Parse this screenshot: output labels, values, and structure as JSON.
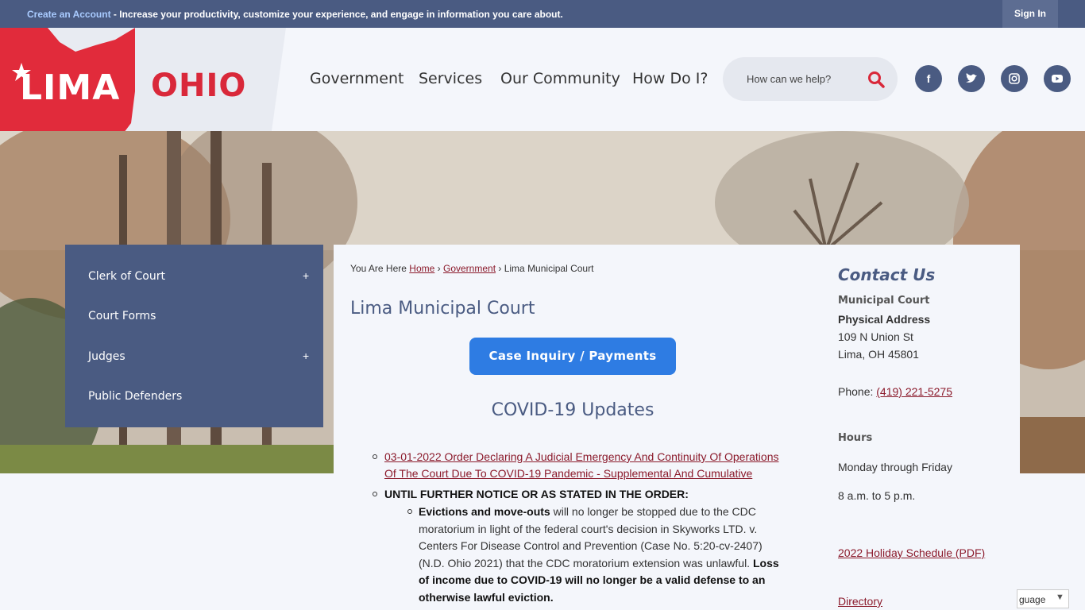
{
  "topbar": {
    "create_account": "Create an Account",
    "message": " - Increase your productivity, customize your experience, and engage in information you care about.",
    "sign_in": "Sign In"
  },
  "logo": {
    "lima": "LIMA",
    "ohio": "OHIO"
  },
  "nav": {
    "items": [
      "Government",
      "Services",
      "Our Community",
      "How Do I?"
    ]
  },
  "search": {
    "placeholder": "How can we help?"
  },
  "social": {
    "facebook": "f",
    "twitter": "t",
    "instagram": "ig",
    "youtube": "yt"
  },
  "sidebar": {
    "items": [
      {
        "label": "Clerk of Court",
        "expand": "+"
      },
      {
        "label": "Court Forms",
        "expand": ""
      },
      {
        "label": "Judges",
        "expand": "+"
      },
      {
        "label": "Public Defenders",
        "expand": ""
      }
    ]
  },
  "breadcrumb": {
    "prefix": "You Are Here",
    "home": "Home",
    "government": "Government",
    "current": "Lima Municipal Court",
    "sep": "›"
  },
  "main": {
    "title": "Lima Municipal Court",
    "case_button": "Case Inquiry / Payments",
    "covid_heading": "COVID-19 Updates",
    "order_link_1": "03-01-2022 Order Declaring A Judicial Emergency And Continuity Of Operations",
    "order_link_2": "Of The Court Due To COVID-19 Pandemic - Supplemental And Cumulative",
    "notice": "UNTIL FURTHER NOTICE OR AS STATED IN THE ORDER:",
    "evictions_bold": "Evictions and move-outs",
    "evictions_1": " will no longer be stopped due to the CDC",
    "evictions_2": "moratorium in light of the federal court's decision in Skyworks LTD. v.",
    "evictions_3": "Centers For Disease Control and Prevention (Case No. 5:20-cv-2407)",
    "evictions_4": "(N.D. Ohio 2021) that the CDC moratorium extension was unlawful. ",
    "evictions_4b": "Loss",
    "evictions_5": "of income due to COVID-19 will no longer be a valid defense to an",
    "evictions_6": "otherwise lawful eviction."
  },
  "contact": {
    "heading": "Contact Us",
    "org": "Municipal Court",
    "address_label": "Physical Address",
    "street": "109 N Union St",
    "city": "Lima, OH 45801",
    "phone_label": "Phone: ",
    "phone": "(419) 221-5275",
    "hours_label": "Hours",
    "days": "Monday through Friday",
    "times": "8 a.m. to 5 p.m.",
    "holiday_link": "2022 Holiday Schedule (PDF)",
    "directory_link": "Directory"
  },
  "language": {
    "label": "guage",
    "arrow": "▼"
  },
  "colors": {
    "brand_blue": "#4a5b82",
    "brand_red": "#d9283a",
    "link_red": "#8b1a2b",
    "button_blue": "#2e7ce3"
  }
}
